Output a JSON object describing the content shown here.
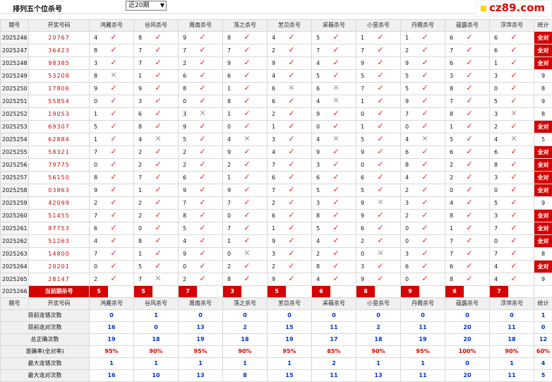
{
  "header": {
    "title": "排列五个位杀号",
    "select_value": "近20期",
    "logo_text": "cz89.com"
  },
  "columns": [
    "期号",
    "开奖号码",
    "鸿雁杀号",
    "谷风杀号",
    "周南杀号",
    "荡之杀号",
    "苤苡杀号",
    "采薇杀号",
    "小旻杀号",
    "丹霞杀号",
    "蕴露杀号",
    "浮萍杀号",
    "统计"
  ],
  "rows": [
    {
      "p": "2025246",
      "n": "20767",
      "k": [
        "4",
        "8",
        "9",
        "8",
        "4",
        "5",
        "1",
        "1",
        "6",
        "6"
      ],
      "r": [
        1,
        1,
        1,
        1,
        1,
        1,
        1,
        1,
        1,
        1
      ],
      "s": "全对"
    },
    {
      "p": "2025247",
      "n": "36423",
      "k": [
        "8",
        "7",
        "7",
        "7",
        "2",
        "7",
        "7",
        "2",
        "7",
        "6"
      ],
      "r": [
        1,
        1,
        1,
        1,
        1,
        1,
        1,
        1,
        1,
        1
      ],
      "s": "全对"
    },
    {
      "p": "2025248",
      "n": "98385",
      "k": [
        "3",
        "7",
        "2",
        "9",
        "9",
        "4",
        "9",
        "9",
        "6",
        "1"
      ],
      "r": [
        1,
        1,
        1,
        1,
        1,
        1,
        1,
        1,
        1,
        1
      ],
      "s": "全对"
    },
    {
      "p": "2025249",
      "n": "53208",
      "k": [
        "8",
        "1",
        "6",
        "6",
        "4",
        "5",
        "5",
        "5",
        "3",
        "3"
      ],
      "r": [
        0,
        1,
        1,
        1,
        1,
        1,
        1,
        1,
        1,
        1
      ],
      "s": "9"
    },
    {
      "p": "2025250",
      "n": "17806",
      "k": [
        "9",
        "9",
        "8",
        "1",
        "6",
        "6",
        "7",
        "5",
        "8",
        "0"
      ],
      "r": [
        1,
        1,
        1,
        1,
        0,
        0,
        1,
        1,
        1,
        1
      ],
      "s": "8"
    },
    {
      "p": "2025251",
      "n": "55854",
      "k": [
        "0",
        "3",
        "0",
        "8",
        "6",
        "4",
        "1",
        "9",
        "7",
        "5"
      ],
      "r": [
        1,
        1,
        1,
        1,
        1,
        0,
        1,
        1,
        1,
        1
      ],
      "s": "9"
    },
    {
      "p": "2025252",
      "n": "19053",
      "k": [
        "1",
        "6",
        "3",
        "1",
        "2",
        "9",
        "0",
        "7",
        "8",
        "3"
      ],
      "r": [
        1,
        1,
        0,
        1,
        1,
        1,
        1,
        1,
        1,
        0
      ],
      "s": "8"
    },
    {
      "p": "2025253",
      "n": "69307",
      "k": [
        "5",
        "8",
        "9",
        "0",
        "1",
        "0",
        "1",
        "0",
        "1",
        "2"
      ],
      "r": [
        1,
        1,
        1,
        1,
        1,
        1,
        1,
        1,
        1,
        1
      ],
      "s": "全对"
    },
    {
      "p": "2025254",
      "n": "62884",
      "k": [
        "1",
        "4",
        "5",
        "4",
        "3",
        "4",
        "5",
        "4",
        "5",
        "4"
      ],
      "r": [
        1,
        0,
        1,
        0,
        1,
        0,
        1,
        0,
        1,
        0
      ],
      "s": "5"
    },
    {
      "p": "2025255",
      "n": "58321",
      "k": [
        "7",
        "2",
        "2",
        "9",
        "4",
        "9",
        "9",
        "6",
        "6",
        "6"
      ],
      "r": [
        1,
        1,
        1,
        1,
        1,
        1,
        1,
        1,
        1,
        1
      ],
      "s": "全对"
    },
    {
      "p": "2025256",
      "n": "79775",
      "k": [
        "0",
        "2",
        "2",
        "2",
        "7",
        "3",
        "0",
        "8",
        "2",
        "8"
      ],
      "r": [
        1,
        1,
        1,
        1,
        1,
        1,
        1,
        1,
        1,
        1
      ],
      "s": "全对"
    },
    {
      "p": "2025257",
      "n": "56150",
      "k": [
        "8",
        "7",
        "6",
        "1",
        "6",
        "6",
        "6",
        "4",
        "2",
        "3"
      ],
      "r": [
        1,
        1,
        1,
        1,
        1,
        1,
        1,
        1,
        1,
        1
      ],
      "s": "全对"
    },
    {
      "p": "2025258",
      "n": "03863",
      "k": [
        "9",
        "1",
        "9",
        "9",
        "7",
        "5",
        "5",
        "2",
        "0",
        "0"
      ],
      "r": [
        1,
        1,
        1,
        1,
        1,
        1,
        1,
        1,
        1,
        1
      ],
      "s": "全对"
    },
    {
      "p": "2025259",
      "n": "42099",
      "k": [
        "2",
        "2",
        "7",
        "7",
        "2",
        "3",
        "9",
        "3",
        "4",
        "5"
      ],
      "r": [
        1,
        1,
        1,
        1,
        1,
        1,
        0,
        1,
        1,
        1
      ],
      "s": "9"
    },
    {
      "p": "2025260",
      "n": "51455",
      "k": [
        "7",
        "2",
        "8",
        "0",
        "6",
        "8",
        "9",
        "2",
        "8",
        "3"
      ],
      "r": [
        1,
        1,
        1,
        1,
        1,
        1,
        1,
        1,
        1,
        1
      ],
      "s": "全对"
    },
    {
      "p": "2025261",
      "n": "87753",
      "k": [
        "6",
        "0",
        "5",
        "7",
        "1",
        "5",
        "6",
        "0",
        "1",
        "7"
      ],
      "r": [
        1,
        1,
        1,
        1,
        1,
        1,
        1,
        1,
        1,
        1
      ],
      "s": "全对"
    },
    {
      "p": "2025262",
      "n": "51263",
      "k": [
        "4",
        "8",
        "4",
        "1",
        "9",
        "4",
        "2",
        "0",
        "7",
        "0"
      ],
      "r": [
        1,
        1,
        1,
        1,
        1,
        1,
        1,
        1,
        1,
        1
      ],
      "s": "全对"
    },
    {
      "p": "2025263",
      "n": "14800",
      "k": [
        "7",
        "1",
        "9",
        "0",
        "3",
        "2",
        "0",
        "3",
        "7",
        "7"
      ],
      "r": [
        1,
        1,
        1,
        0,
        1,
        1,
        0,
        1,
        1,
        1
      ],
      "s": "8"
    },
    {
      "p": "2025264",
      "n": "20201",
      "k": [
        "0",
        "5",
        "0",
        "2",
        "2",
        "8",
        "3",
        "6",
        "6",
        "4"
      ],
      "r": [
        1,
        1,
        1,
        1,
        1,
        1,
        1,
        1,
        1,
        1
      ],
      "s": "全对"
    },
    {
      "p": "2025265",
      "n": "28147",
      "k": [
        "2",
        "7",
        "2",
        "8",
        "9",
        "4",
        "9",
        "0",
        "8",
        "4"
      ],
      "r": [
        1,
        0,
        1,
        1,
        1,
        1,
        1,
        1,
        1,
        1
      ],
      "s": "9"
    }
  ],
  "current": {
    "p": "2025266",
    "label": "当前期杀号",
    "k": [
      "5",
      "5",
      "7",
      "3",
      "5",
      "6",
      "8",
      "9",
      "6",
      "7"
    ]
  },
  "stats": [
    {
      "label": "目前连错次数",
      "v": [
        "0",
        "1",
        "0",
        "0",
        "0",
        "0",
        "0",
        "0",
        "0",
        "0",
        "1"
      ]
    },
    {
      "label": "目前连对次数",
      "v": [
        "16",
        "0",
        "13",
        "2",
        "15",
        "11",
        "2",
        "11",
        "20",
        "11",
        "0"
      ]
    },
    {
      "label": "总正确次数",
      "v": [
        "19",
        "18",
        "19",
        "18",
        "19",
        "17",
        "18",
        "19",
        "20",
        "18",
        "12"
      ]
    },
    {
      "label": "准确率(全对率)",
      "v": [
        "95%",
        "90%",
        "95%",
        "90%",
        "95%",
        "85%",
        "90%",
        "95%",
        "100%",
        "90%",
        "60%"
      ]
    },
    {
      "label": "最大连错次数",
      "v": [
        "1",
        "1",
        "1",
        "1",
        "1",
        "2",
        "1",
        "1",
        "0",
        "1",
        "4"
      ]
    },
    {
      "label": "最大连对次数",
      "v": [
        "16",
        "10",
        "13",
        "8",
        "15",
        "11",
        "13",
        "11",
        "20",
        "11",
        "5"
      ]
    }
  ],
  "icons": {
    "check": "check-icon",
    "cross": "cross-icon"
  }
}
